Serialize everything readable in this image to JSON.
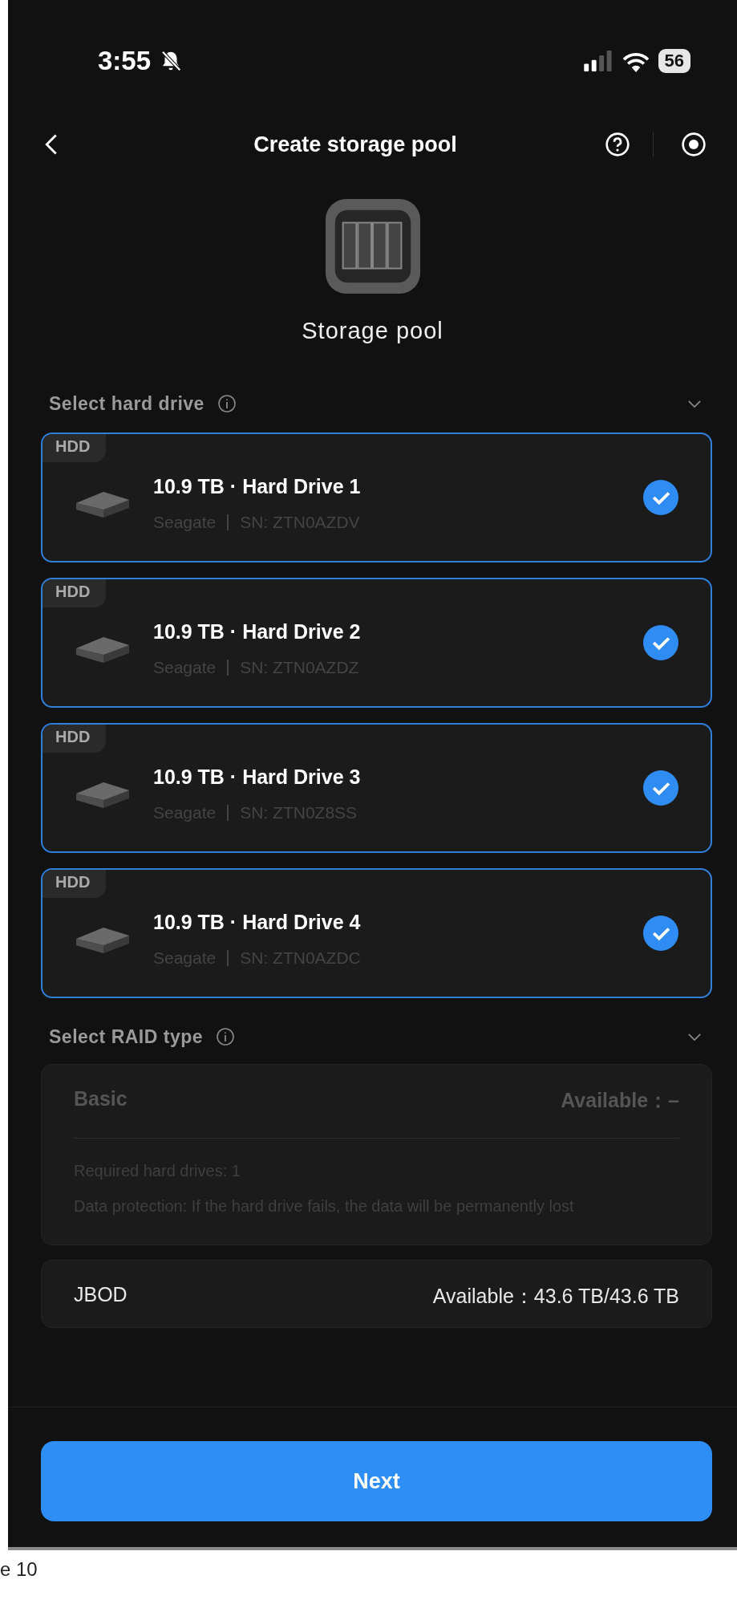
{
  "status_bar": {
    "time": "3:55",
    "battery": "56"
  },
  "nav": {
    "title": "Create storage pool"
  },
  "hero": {
    "label": "Storage pool"
  },
  "drive_section": {
    "title": "Select hard drive",
    "expanded": true
  },
  "drives": [
    {
      "tag": "HDD",
      "title": "10.9 TB · Hard Drive 1",
      "brand": "Seagate",
      "sn": "SN: ZTN0AZDV",
      "selected": true
    },
    {
      "tag": "HDD",
      "title": "10.9 TB · Hard Drive 2",
      "brand": "Seagate",
      "sn": "SN: ZTN0AZDZ",
      "selected": true
    },
    {
      "tag": "HDD",
      "title": "10.9 TB · Hard Drive 3",
      "brand": "Seagate",
      "sn": "SN: ZTN0Z8SS",
      "selected": true
    },
    {
      "tag": "HDD",
      "title": "10.9 TB · Hard Drive 4",
      "brand": "Seagate",
      "sn": "SN: ZTN0AZDC",
      "selected": true
    }
  ],
  "raid_section": {
    "title": "Select RAID type",
    "expanded": true
  },
  "raid_types": [
    {
      "name": "Basic",
      "available": "Available：–",
      "details": [
        "Required hard drives: 1",
        "Data protection: If the hard drive fails, the data will be permanently lost"
      ],
      "disabled": true
    },
    {
      "name": "JBOD",
      "available": "Available：43.6 TB/43.6 TB",
      "disabled": false
    }
  ],
  "next_button": {
    "label": "Next"
  },
  "page_footer": {
    "text": "e 10"
  }
}
